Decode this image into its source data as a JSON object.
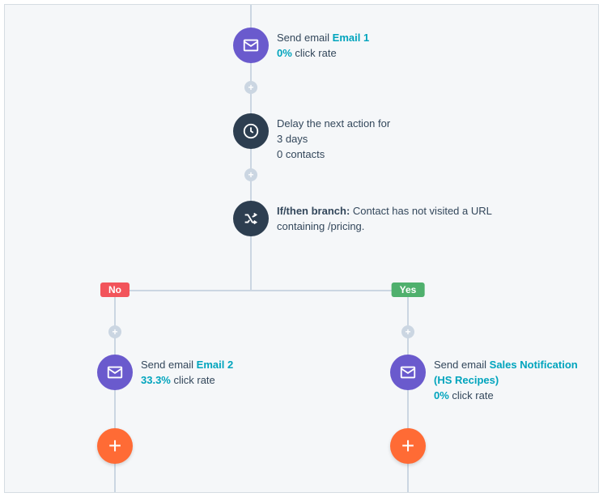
{
  "nodes": {
    "email1": {
      "action_prefix": "Send email ",
      "link": "Email 1",
      "stat_value": "0%",
      "stat_label": " click rate"
    },
    "delay": {
      "line1": "Delay the next action for",
      "line2": "3 days",
      "line3": "0 contacts"
    },
    "branch": {
      "label": "If/then branch:",
      "condition": " Contact has not visited a URL containing /pricing."
    },
    "email2": {
      "action_prefix": "Send email ",
      "link": "Email 2",
      "stat_value": "33.3%",
      "stat_label": " click rate"
    },
    "email3": {
      "action_prefix": "Send email ",
      "link": "Sales Notification (HS Recipes)",
      "stat_value": "0%",
      "stat_label": " click rate"
    }
  },
  "badges": {
    "no": "No",
    "yes": "Yes"
  },
  "colors": {
    "purple": "#6a5acd",
    "navy": "#2d3e50",
    "orange": "#ff6b35",
    "teal": "#00a4bd",
    "red": "#f2545b",
    "green": "#4fb06d"
  }
}
